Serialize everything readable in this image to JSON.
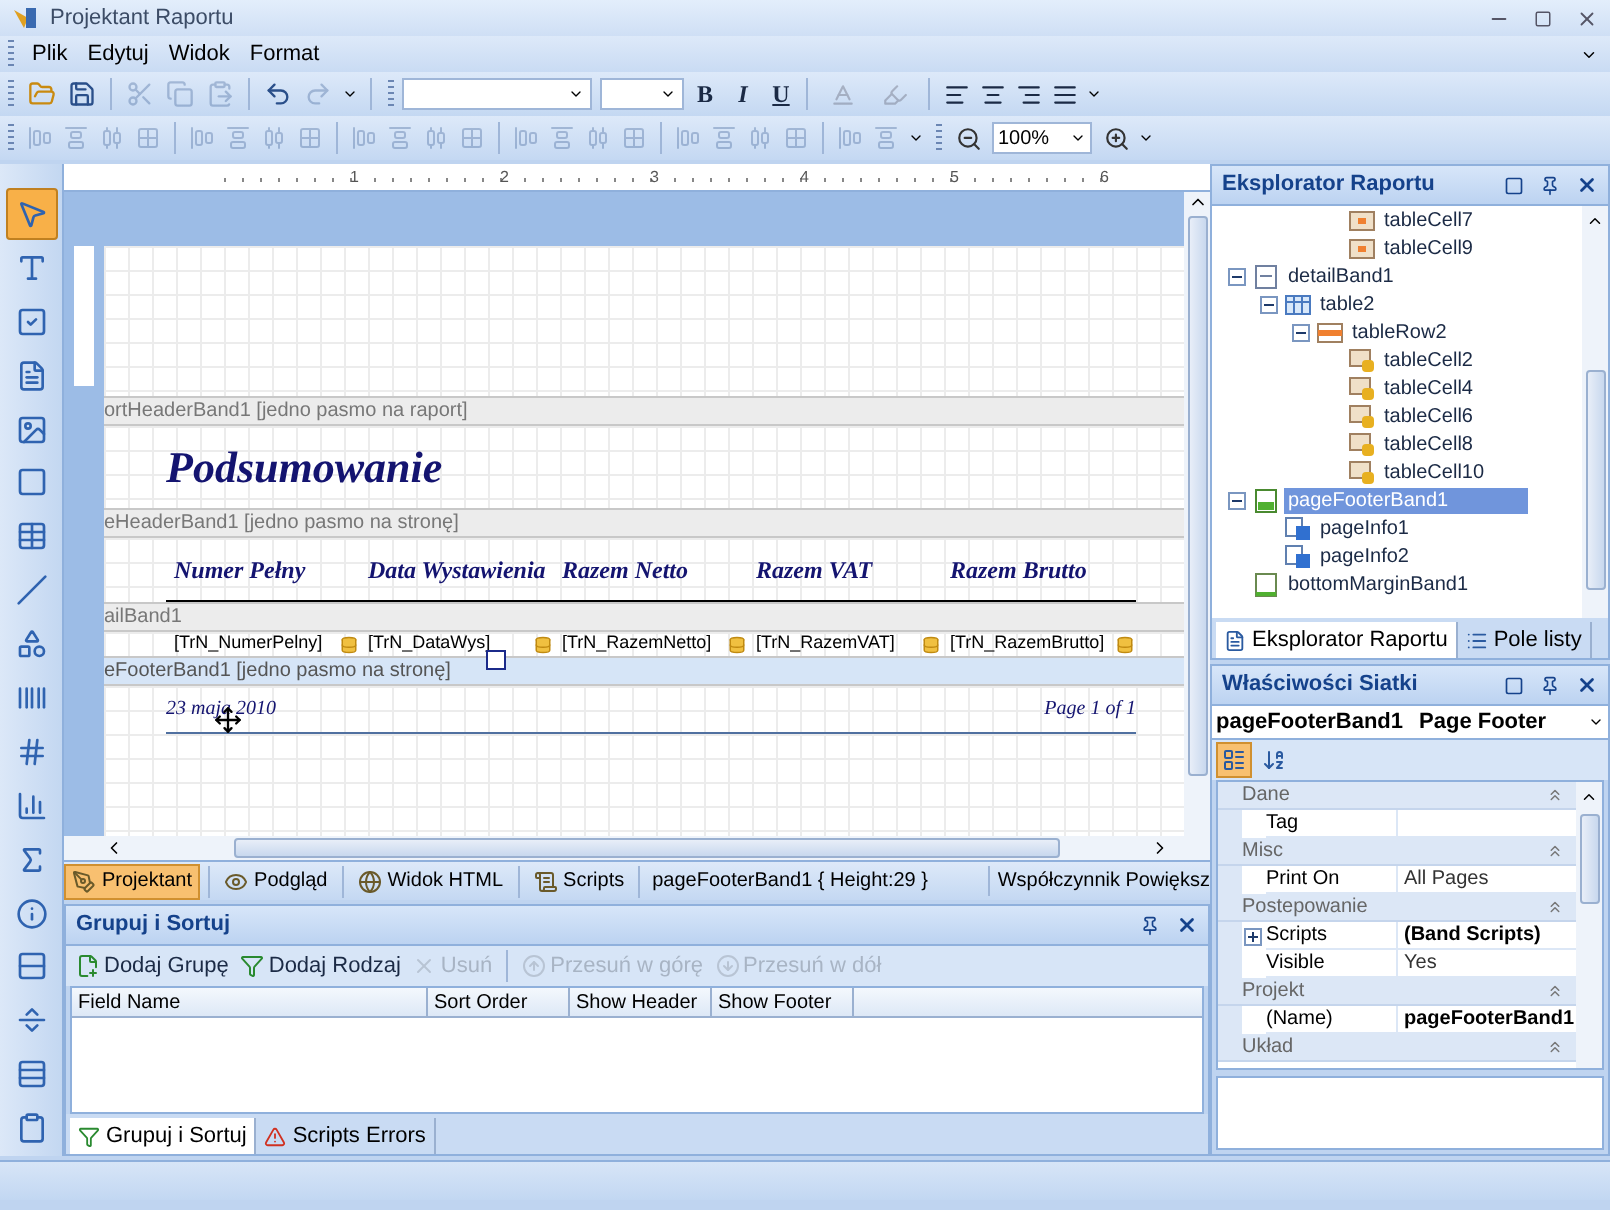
{
  "window": {
    "title": "Projektant Raportu"
  },
  "menu": [
    "Plik",
    "Edytuj",
    "Widok",
    "Format"
  ],
  "toolbar_1": {
    "file_buttons": [
      {
        "disabled": false
      },
      {
        "disabled": false
      },
      {
        "disabled": true
      },
      {
        "disabled": true
      },
      {
        "disabled": true
      },
      {
        "disabled": false
      },
      {
        "disabled": true
      }
    ],
    "font_buttons": [
      "B",
      "I",
      "U"
    ],
    "color_buttons": [
      {
        "disabled": true
      },
      {
        "disabled": true
      }
    ],
    "align_buttons": [
      {
        "disabled": false
      },
      {
        "disabled": false
      },
      {
        "disabled": false
      },
      {
        "disabled": false
      }
    ]
  },
  "toolbar_2": {
    "layout_buttons": [
      {
        "disabled": true
      },
      {
        "disabled": true
      },
      {
        "disabled": true
      },
      {
        "disabled": true
      },
      {
        "disabled": true
      },
      {
        "disabled": true
      },
      {
        "disabled": true
      },
      {
        "disabled": true
      },
      {
        "disabled": true
      },
      {
        "disabled": true
      },
      {
        "disabled": true
      },
      {
        "disabled": true
      },
      {
        "disabled": true
      },
      {
        "disabled": true
      },
      {
        "disabled": true
      },
      {
        "disabled": true
      },
      {
        "disabled": true
      },
      {
        "disabled": true
      },
      {
        "disabled": true
      },
      {
        "disabled": true
      },
      {
        "disabled": true
      },
      {
        "disabled": true
      }
    ],
    "zoom": "100%"
  },
  "toolbox": [
    {
      "selected": true
    },
    {
      "selected": false
    },
    {
      "selected": false
    },
    {
      "selected": false
    },
    {
      "selected": false
    },
    {
      "selected": false
    },
    {
      "selected": false
    },
    {
      "selected": false
    },
    {
      "selected": false
    },
    {
      "selected": false
    },
    {
      "selected": false
    },
    {
      "selected": false
    },
    {
      "selected": false
    },
    {
      "selected": false
    },
    {
      "selected": false
    },
    {
      "selected": false
    },
    {
      "selected": false
    },
    {
      "selected": false
    }
  ],
  "ruler": [
    "1",
    "2",
    "3",
    "4",
    "5",
    "6"
  ],
  "bands": [
    {
      "kind": "title",
      "caption": "ortHeaderBand1 [jedno pasmo na raport]",
      "selected": false,
      "title": "Podsumowanie"
    },
    {
      "kind": "header",
      "caption": "eHeaderBand1 [jedno pasmo na stronę]",
      "selected": false,
      "columns": [
        "Numer Pełny",
        "Data Wystawienia",
        "Razem Netto",
        "Razem VAT",
        "Razem Brutto"
      ]
    },
    {
      "kind": "detail",
      "caption": "ailBand1",
      "selected": false,
      "fields": [
        "[TrN_NumerPelny]",
        "[TrN_DataWys]",
        "[TrN_RazemNetto]",
        "[TrN_RazemVAT]",
        "[TrN_RazemBrutto]"
      ]
    },
    {
      "kind": "footer",
      "caption": "eFooterBand1 [jedno pasmo na stronę]",
      "selected": true,
      "left": "23 maja 2010",
      "right": "Page 1 of 1"
    }
  ],
  "design_tabs": [
    {
      "label": "Projektant",
      "selected": true
    },
    {
      "label": "Podgląd",
      "selected": false
    },
    {
      "label": "Widok HTML",
      "selected": false
    },
    {
      "label": "Scripts",
      "selected": false
    }
  ],
  "design_status": "pageFooterBand1 { Height:29 }",
  "zoom_label": "Współczynnik Powiększ",
  "group_sort": {
    "title": "Grupuj i Sortuj",
    "actions": [
      {
        "label": "Dodaj Grupę",
        "disabled": false
      },
      {
        "label": "Dodaj Rodzaj",
        "disabled": false
      },
      {
        "label": "Usuń",
        "disabled": true
      },
      {
        "label": "Przesuń w górę",
        "disabled": true
      },
      {
        "label": "Przesuń w dół",
        "disabled": true
      }
    ],
    "columns": [
      "Field Name",
      "Sort Order",
      "Show Header",
      "Show Footer"
    ],
    "tabs": [
      {
        "label": "Grupuj i Sortuj",
        "selected": true
      },
      {
        "label": "Scripts Errors",
        "selected": false
      }
    ]
  },
  "explorer": {
    "title": "Eksplorator Raportu",
    "tree": [
      {
        "children": [
          {
            "children": [
              {
                "children": [
                  {
                    "label": "tableCell7",
                    "kind": "cell",
                    "selected": false
                  },
                  {
                    "label": "tableCell9",
                    "kind": "cell",
                    "selected": false
                  }
                ]
              }
            ]
          }
        ]
      },
      {
        "label": "detailBand1",
        "kind": "band",
        "selected": false,
        "children": [
          {
            "label": "table2",
            "kind": "table",
            "selected": false,
            "children": [
              {
                "label": "tableRow2",
                "kind": "row",
                "selected": false,
                "children": [
                  {
                    "label": "tableCell2",
                    "kind": "bound-cell",
                    "selected": false
                  },
                  {
                    "label": "tableCell4",
                    "kind": "bound-cell",
                    "selected": false
                  },
                  {
                    "label": "tableCell6",
                    "kind": "bound-cell",
                    "selected": false
                  },
                  {
                    "label": "tableCell8",
                    "kind": "bound-cell",
                    "selected": false
                  },
                  {
                    "label": "tableCell10",
                    "kind": "bound-cell",
                    "selected": false
                  }
                ]
              }
            ]
          }
        ]
      },
      {
        "label": "pageFooterBand1",
        "kind": "footer",
        "selected": true,
        "children": [
          {
            "label": "pageInfo1",
            "kind": "info",
            "selected": false
          },
          {
            "label": "pageInfo2",
            "kind": "info",
            "selected": false
          }
        ]
      },
      {
        "label": "bottomMarginBand1",
        "kind": "margin",
        "selected": false
      }
    ],
    "tabs": [
      {
        "label": "Eksplorator Raportu",
        "selected": true
      },
      {
        "label": "Pole listy",
        "selected": false
      }
    ]
  },
  "properties": {
    "title": "Właściwości Siatki",
    "object": "pageFooterBand1",
    "type": "Page Footer",
    "sort_buttons": [
      {
        "selected": true
      },
      {
        "selected": false
      }
    ],
    "categories": [
      {
        "name": "Dane",
        "props": [
          {
            "name": "Tag",
            "expandable": false
          }
        ]
      },
      {
        "name": "Misc",
        "props": [
          {
            "name": "Print On",
            "value": "All Pages",
            "bold": false,
            "expandable": false
          }
        ]
      },
      {
        "name": "Postepowanie",
        "props": [
          {
            "name": "Scripts",
            "value": "(Band Scripts)",
            "bold": true,
            "expandable": true
          },
          {
            "name": "Visible",
            "value": "Yes",
            "bold": false,
            "expandable": false
          }
        ]
      },
      {
        "name": "Projekt",
        "props": [
          {
            "name": "(Name)",
            "value": "pageFooterBand1",
            "bold": true,
            "expandable": false
          }
        ]
      },
      {
        "name": "Układ"
      }
    ]
  }
}
